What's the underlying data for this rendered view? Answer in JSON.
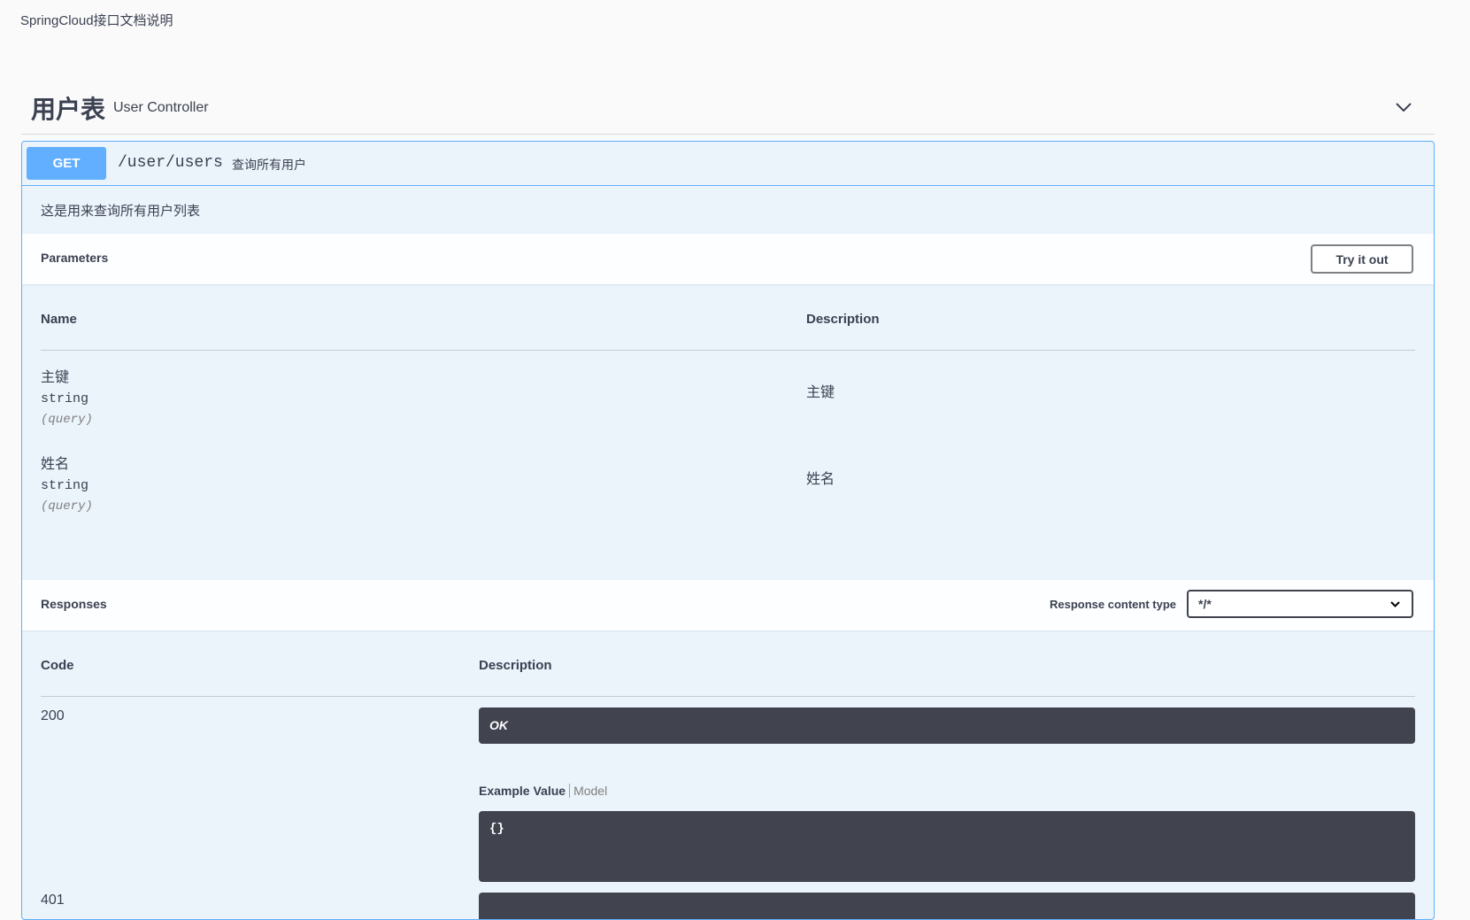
{
  "page": {
    "subtitle": "SpringCloud接口文档说明"
  },
  "tag": {
    "name": "用户表",
    "description": "User Controller"
  },
  "operation": {
    "method": "GET",
    "path": "/user/users",
    "summary": "查询所有用户",
    "description": "这是用来查询所有用户列表"
  },
  "parameters": {
    "title": "Parameters",
    "try_label": "Try it out",
    "col_name": "Name",
    "col_description": "Description",
    "items": [
      {
        "name": "主键",
        "type": "string",
        "in": "(query)",
        "description": "主键"
      },
      {
        "name": "姓名",
        "type": "string",
        "in": "(query)",
        "description": "姓名"
      }
    ]
  },
  "responses": {
    "title": "Responses",
    "content_type_label": "Response content type",
    "content_type_value": "*/*",
    "col_code": "Code",
    "col_description": "Description",
    "items": [
      {
        "code": "200",
        "description": "OK",
        "example_tab": "Example Value",
        "model_tab": "Model",
        "example_body": "{}"
      },
      {
        "code": "401"
      }
    ]
  },
  "colors": {
    "get_method": "#61affe",
    "opblock_background": "#ebf3fb",
    "code_block": "#41444e"
  },
  "icons": {
    "tag_toggle": "chevron-down-icon",
    "select_toggle": "chevron-down-icon"
  }
}
